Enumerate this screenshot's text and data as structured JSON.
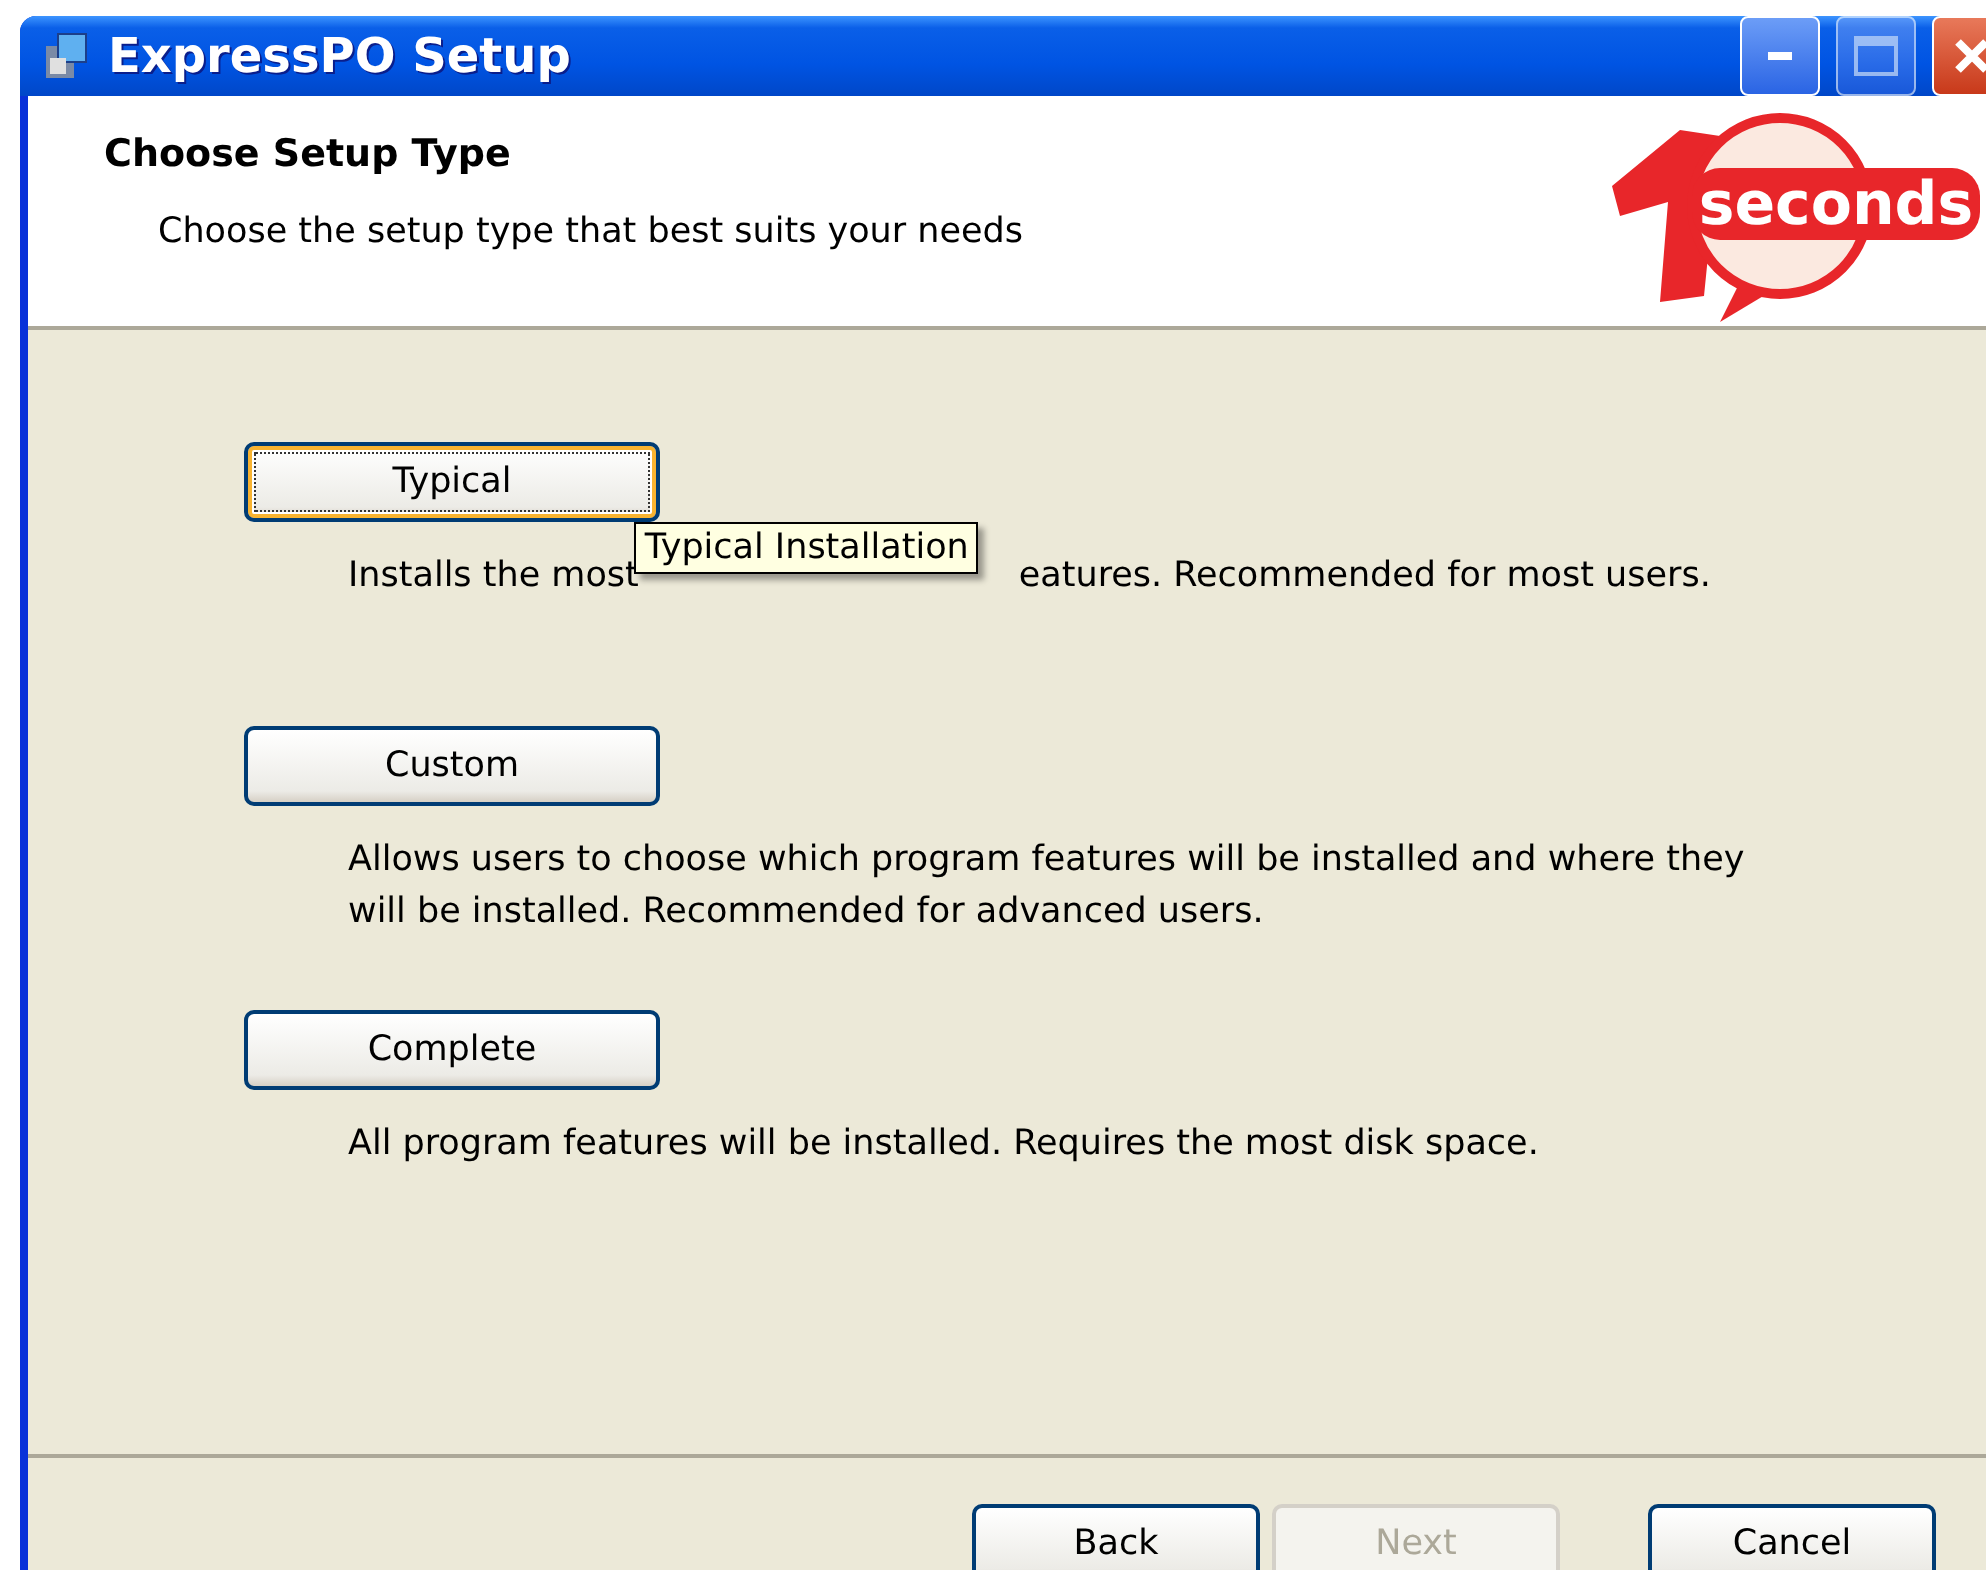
{
  "window": {
    "title": "ExpressPO Setup"
  },
  "header": {
    "title": "Choose Setup Type",
    "subtitle": "Choose the setup type that best suits your needs",
    "logo_text": "seconds"
  },
  "options": [
    {
      "label": "Typical",
      "focused": true,
      "description_parts": [
        "Installs the most",
        "eatures. Recommended for most users."
      ],
      "tooltip": "Typical Installation"
    },
    {
      "label": "Custom",
      "focused": false,
      "description_parts": [
        "Allows users to choose which program features will be installed and where they will be installed. Recommended for advanced users."
      ]
    },
    {
      "label": "Complete",
      "focused": false,
      "description_parts": [
        "All program features will be installed. Requires the most disk space."
      ]
    }
  ],
  "buttons": [
    {
      "label": "Back",
      "disabled": false
    },
    {
      "label": "Next",
      "disabled": true
    },
    {
      "label": "Cancel",
      "disabled": false
    }
  ]
}
